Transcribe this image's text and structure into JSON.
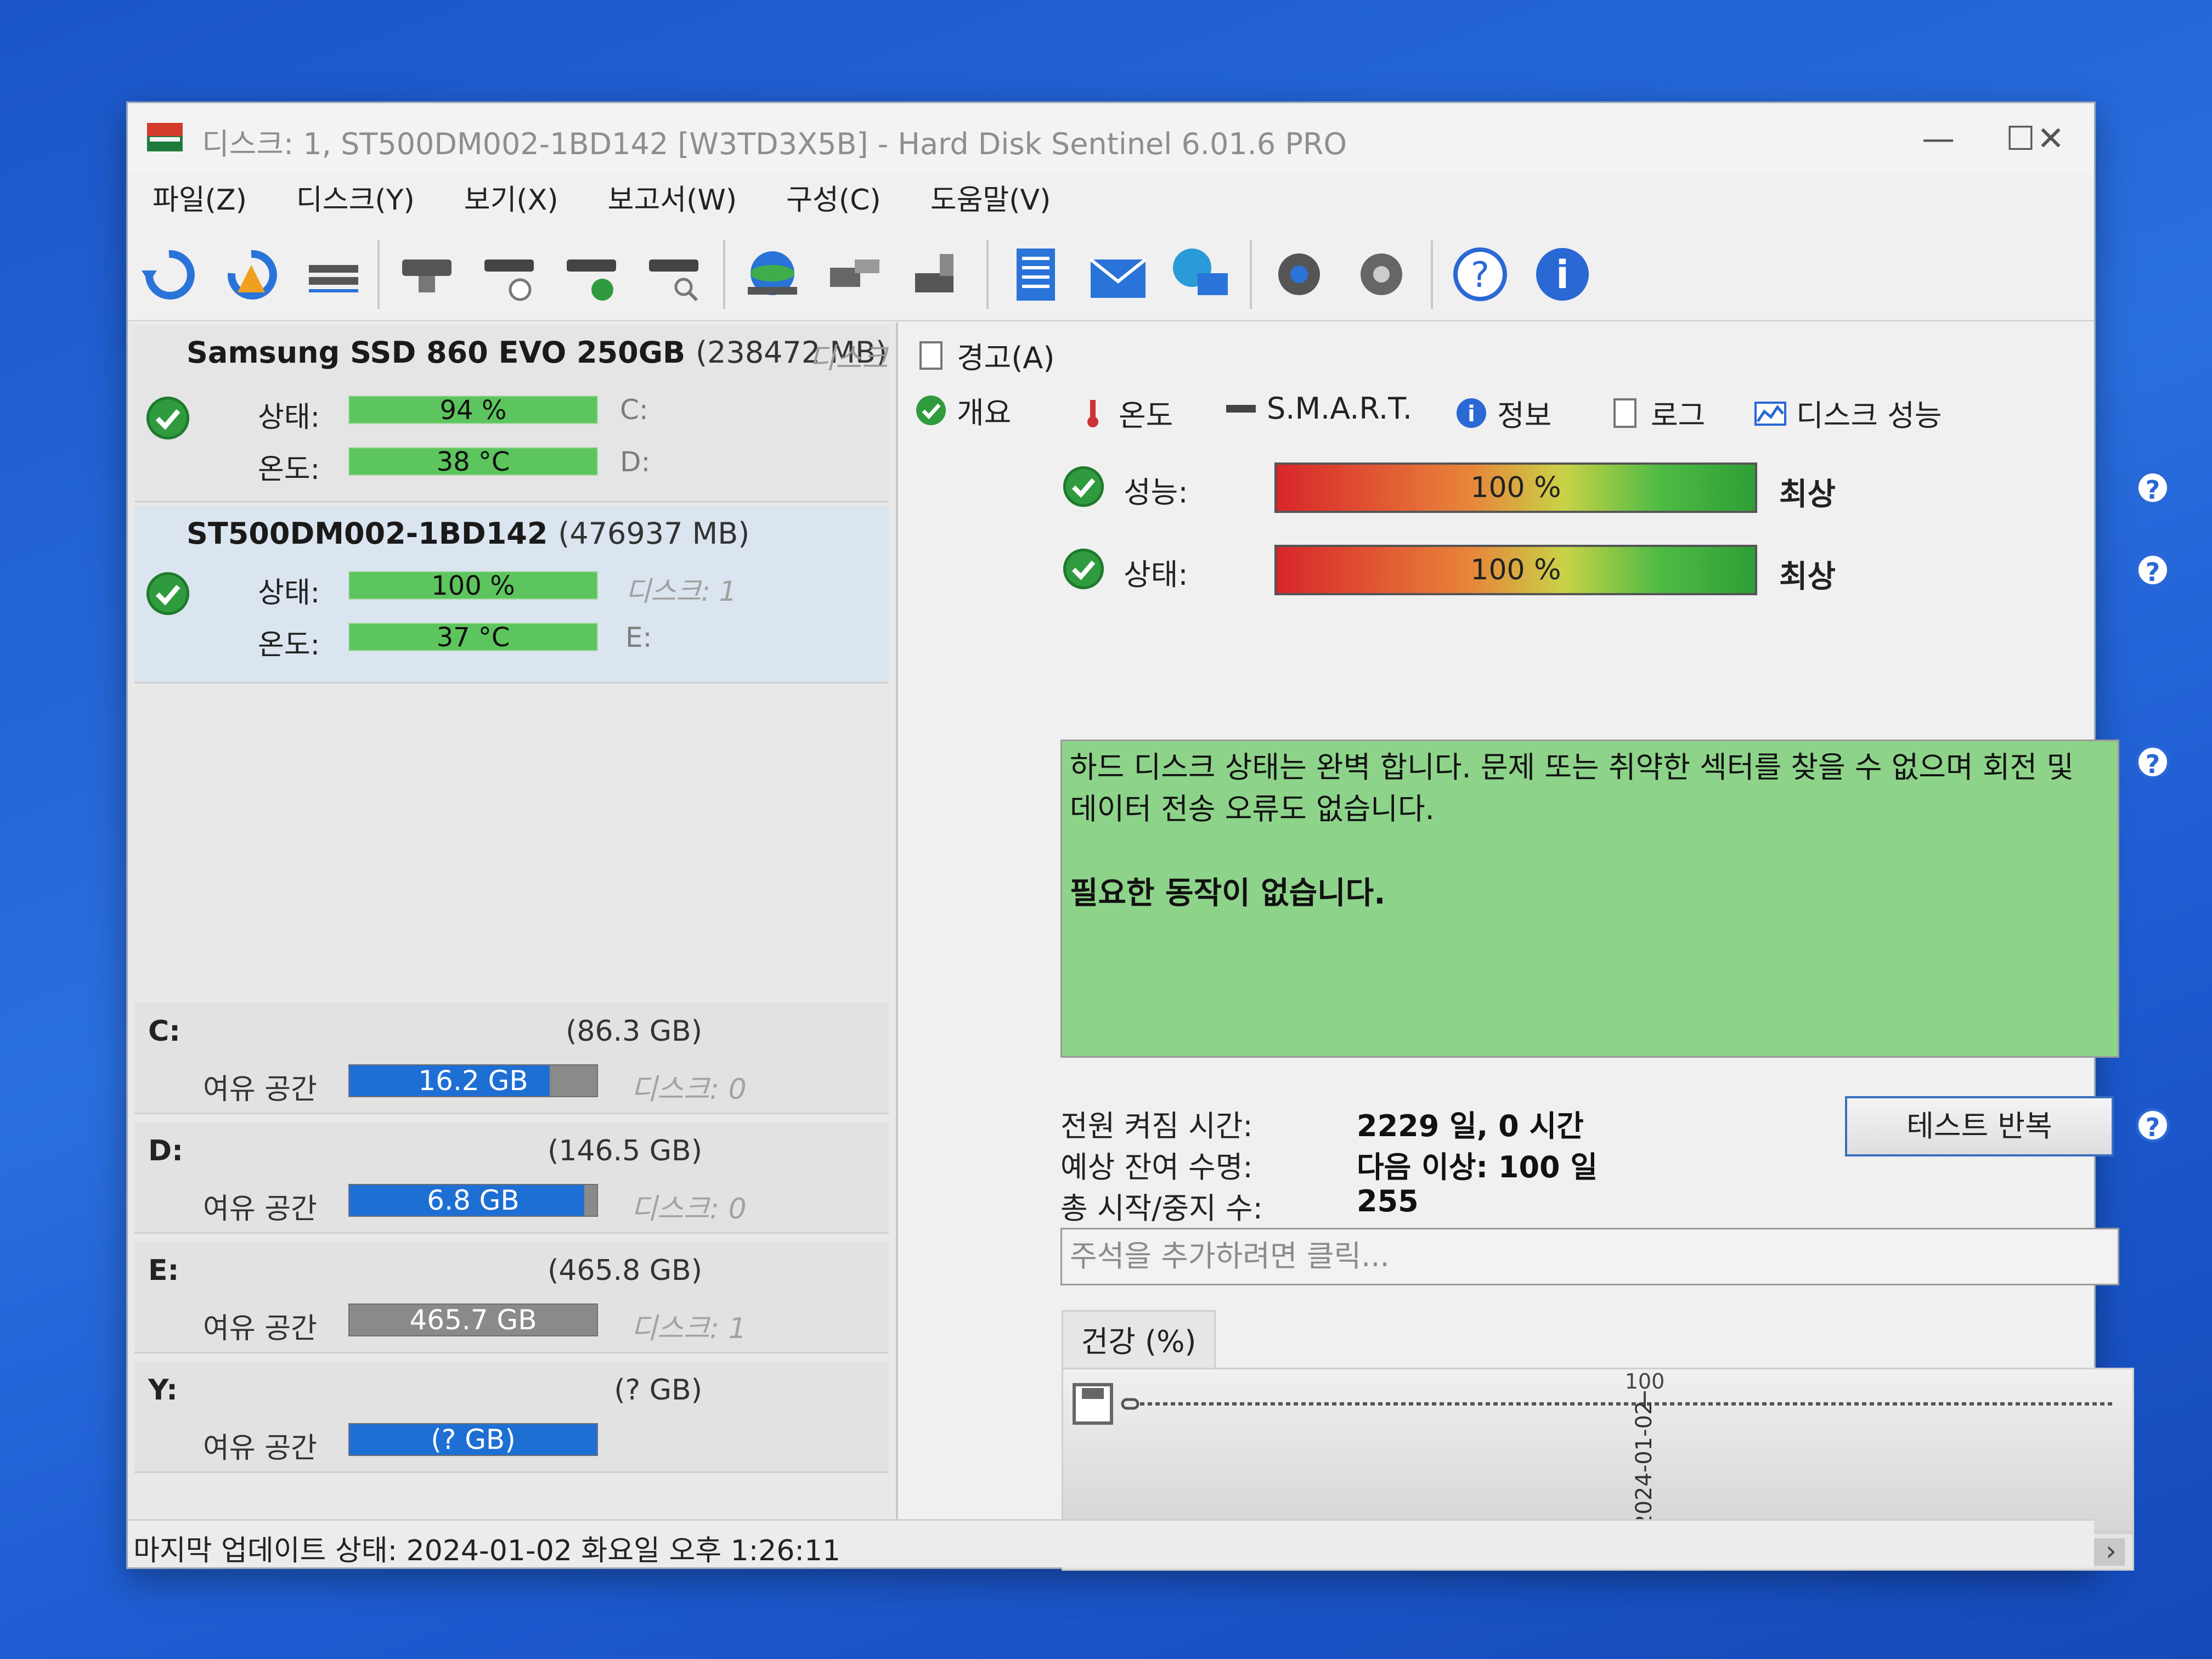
{
  "window": {
    "title": "디스크: 1, ST500DM002-1BD142 [W3TD3X5B]  -  Hard Disk Sentinel 6.01.6 PRO",
    "minimize_glyph": "—",
    "maximize_glyph": "☐",
    "close_glyph": "✕"
  },
  "menu": [
    "파일(Z)",
    "디스크(Y)",
    "보기(X)",
    "보고서(W)",
    "구성(C)",
    "도움말(V)"
  ],
  "toolbar_icons": [
    "refresh-icon",
    "refresh-warning-icon",
    "disk-list-icon",
    "disk-icon",
    "disk-timer-icon",
    "disk-check-icon",
    "disk-search-icon",
    "globe-disk-icon",
    "network-icon",
    "drive-export-icon",
    "report-icon",
    "mail-icon",
    "globe-computer-icon",
    "settings-gear-icon",
    "sound-icon",
    "help-icon",
    "info-icon"
  ],
  "disks": [
    {
      "name": "Samsung SSD 860 EVO 250GB",
      "size": "(238472 MB)",
      "ref": "디스크",
      "status_label": "상태:",
      "status_value": "94 %",
      "status_level": 0.94,
      "temp_label": "온도:",
      "temp_value": "38 °C",
      "side1": "C:",
      "side2": "D:"
    },
    {
      "name": "ST500DM002-1BD142",
      "size": "(476937 MB)",
      "status_label": "상태:",
      "status_value": "100 %",
      "status_level": 1.0,
      "temp_label": "온도:",
      "temp_value": "37 °C",
      "side1": "디스크: 1",
      "side2": "E:"
    }
  ],
  "partitions": [
    {
      "letter": "C:",
      "size": "(86.3 GB)",
      "free_label": "여유 공간",
      "free": "16.2 GB",
      "free_fraction": 0.81,
      "disk": "디스크: 0"
    },
    {
      "letter": "D:",
      "size": "(146.5 GB)",
      "free_label": "여유 공간",
      "free": "6.8 GB",
      "free_fraction": 0.95,
      "disk": "디스크: 0"
    },
    {
      "letter": "E:",
      "size": "(465.8 GB)",
      "free_label": "여유 공간",
      "free": "465.7 GB",
      "free_fraction": 0.0,
      "disk": "디스크: 1"
    },
    {
      "letter": "Y:",
      "size": "(? GB)",
      "free_label": "여유 공간",
      "free": "(? GB)",
      "free_fraction": 1.0,
      "disk": ""
    }
  ],
  "statusbar": "마지막 업데이트 상태: 2024-01-02 화요일 오후 1:26:11",
  "tabs": {
    "alert": "경고(A)",
    "overview": "개요",
    "temperature": "온도",
    "smart": "S.M.A.R.T.",
    "info": "정보",
    "log": "로그",
    "performance": "디스크 성능"
  },
  "overview": {
    "perf_label": "성능:",
    "perf_value": "100 %",
    "perf_rank": "최상",
    "health_label": "상태:",
    "health_value": "100 %",
    "health_rank": "최상",
    "message": "하드 디스크 상태는 완벽 합니다. 문제 또는 취약한 섹터를 찾을 수 없으며 회전 및 데이터 전송 오류도 없습니다.",
    "action": "필요한 동작이 없습니다.",
    "power_on_label": "전원 켜짐 시간:",
    "power_on_value": "2229 일, 0 시간",
    "lifetime_label": "예상 잔여 수명:",
    "lifetime_value": "다음 이상: 100 일",
    "starts_label": "총 시작/중지 수:",
    "starts_value": "255",
    "test_button": "테스트 반복",
    "comment_placeholder": "주석을 추가하려면 클릭...",
    "health_tab": "건강 (%)",
    "graph_value_label": "100",
    "graph_date_label": "2024-01-02",
    "help_glyph": "?"
  }
}
